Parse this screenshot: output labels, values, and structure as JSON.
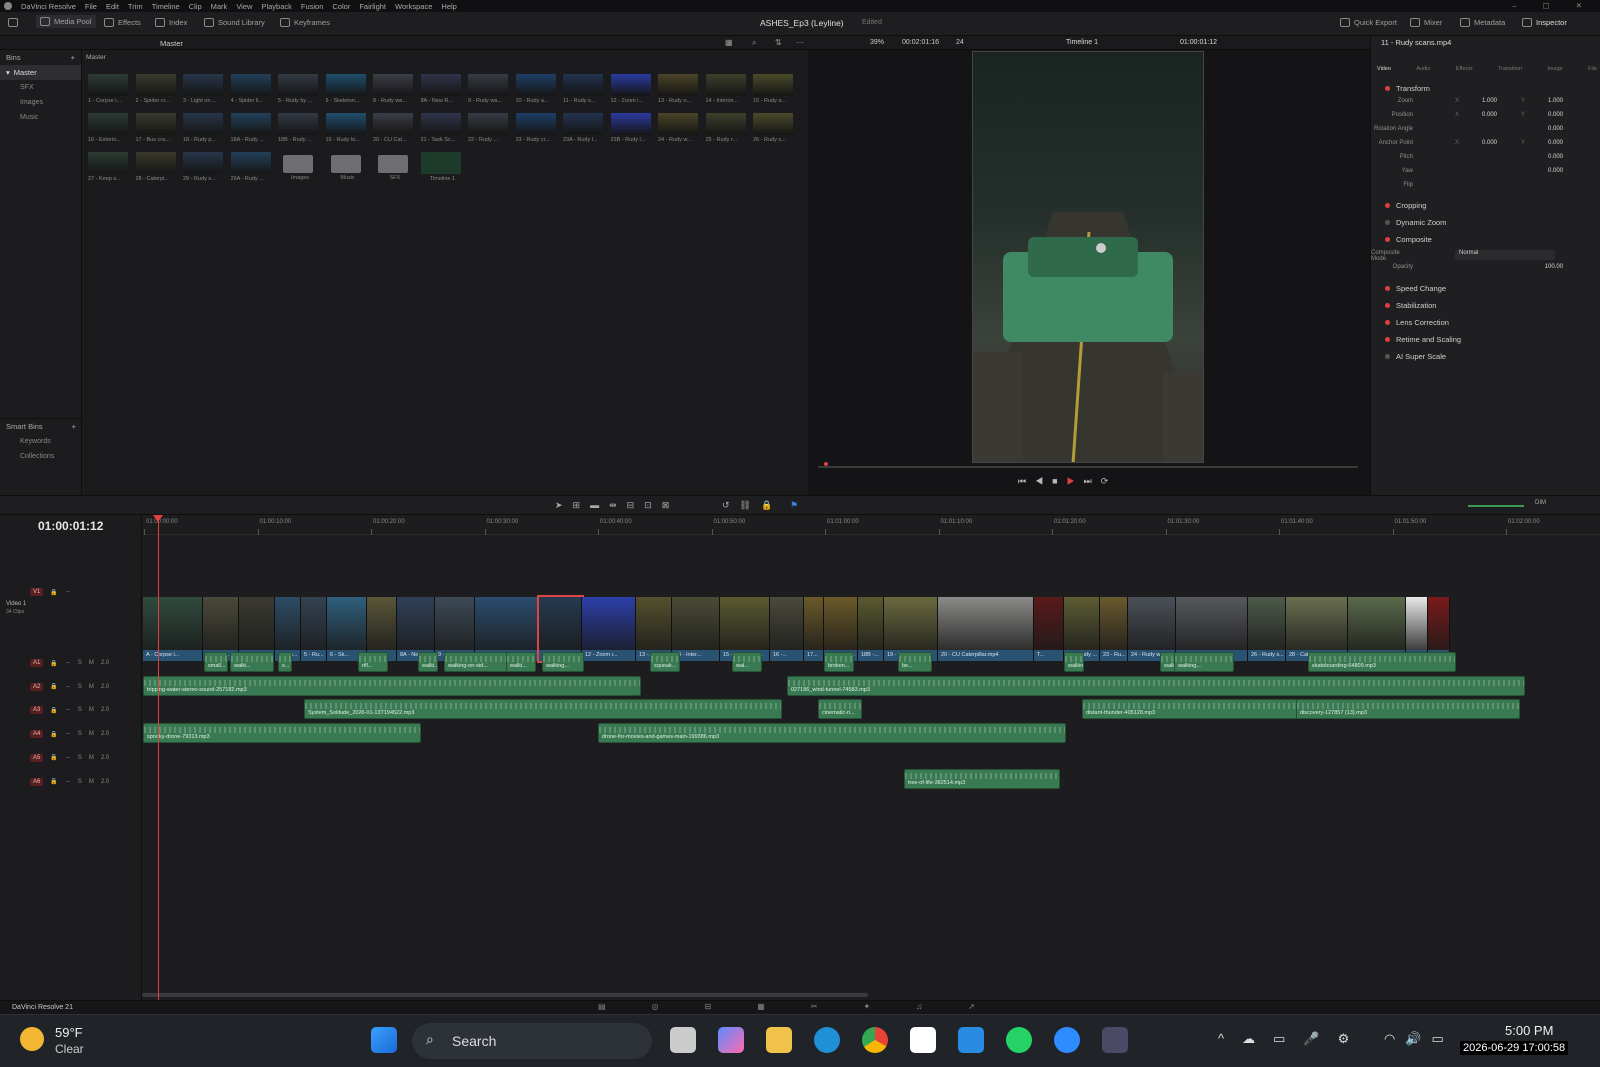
{
  "menubar": {
    "app": "DaVinci Resolve",
    "items": [
      "File",
      "Edit",
      "Trim",
      "Timeline",
      "Clip",
      "Mark",
      "View",
      "Playback",
      "Fusion",
      "Color",
      "Fairlight",
      "Workspace",
      "Help"
    ]
  },
  "toolbar": {
    "left": [
      "Media Pool",
      "Effects",
      "Index",
      "Sound Library",
      "Keyframes"
    ],
    "project_title": "ASHES_Ep3 (Leyline)",
    "project_state": "Edited",
    "right": [
      "Quick Export",
      "Mixer",
      "Metadata",
      "Inspector"
    ]
  },
  "pool": {
    "bins_label": "Bins",
    "current_bin": "Master",
    "bins": [
      "Master",
      "SFX",
      "Images",
      "Music"
    ],
    "smart_bins_label": "Smart Bins",
    "smart_bins": [
      "Keywords",
      "Collections"
    ],
    "header": "Master",
    "clips": [
      "1 - Corpse i...",
      "2 - Spider cr...",
      "3 - Light on ...",
      "4 - Spider li...",
      "5 - Rudy by ...",
      "6 - Skeleton...",
      "8 - Rudy wa...",
      "8A - New R...",
      "9 - Rudy wa...",
      "10 - Rudy a...",
      "11 - Rudy s...",
      "12 - Zoom i...",
      "13 - Rudy o...",
      "14 - Interior...",
      "15 - Rudy a...",
      "16 - Exterio...",
      "17 - Bus cra...",
      "18 - Rudy p...",
      "18A - Rudy ...",
      "18B - Rudy ...",
      "19 - Rudy lo...",
      "20 - CU Cat...",
      "21 - Task Sc...",
      "22 - Rudy ...",
      "23 - Rudy cr...",
      "23A - Rudy l...",
      "23B - Rudy l...",
      "24 - Rudy w...",
      "25 - Rudy r...",
      "26 - Rudy s...",
      "27 - Keep s...",
      "28 - Caterpi...",
      "29 - Rudy s...",
      "29A - Rudy ..."
    ],
    "folders": [
      "Images",
      "Music",
      "SFX"
    ],
    "timeline_item": "Timeline 1"
  },
  "viewer": {
    "zoom": "39%",
    "duration": "00:02:01:16",
    "fps": "24",
    "timeline_name": "Timeline 1",
    "timecode": "01:00:01:12"
  },
  "inspector": {
    "clip_name": "11 - Rudy scans.mp4",
    "tabs": [
      "Video",
      "Audio",
      "Effects",
      "Transition",
      "Image",
      "File"
    ],
    "sections": [
      "Transform",
      "Cropping",
      "Dynamic Zoom",
      "Composite",
      "Speed Change",
      "Stabilization",
      "Lens Correction",
      "Retime and Scaling",
      "AI Super Scale"
    ],
    "transform": {
      "zoom_label": "Zoom",
      "zoom_x": "1.000",
      "zoom_y": "1.000",
      "position_label": "Position",
      "pos_x": "0.000",
      "pos_y": "0.000",
      "rotation_label": "Rotation Angle",
      "rotation": "0.000",
      "anchor_label": "Anchor Point",
      "anchor_x": "0.000",
      "anchor_y": "0.000",
      "pitch_label": "Pitch",
      "pitch": "0.000",
      "yaw_label": "Yaw",
      "yaw": "0.000",
      "flip_label": "Flip"
    },
    "composite": {
      "mode_label": "Composite Mode",
      "mode": "Normal",
      "opacity_label": "Opacity",
      "opacity": "100.00"
    },
    "axis_x": "X",
    "axis_y": "Y"
  },
  "timeline": {
    "timecode": "01:00:01:12",
    "ruler": [
      "01:00:00:00",
      "01:00:10:00",
      "01:00:20:00",
      "01:00:30:00",
      "01:00:40:00",
      "01:00:50:00",
      "01:01:00:00",
      "01:01:10:00",
      "01:01:20:00",
      "01:01:30:00",
      "01:01:40:00",
      "01:01:50:00",
      "01:02:00:00"
    ],
    "video_track": {
      "tag": "V1",
      "name": "Video 1",
      "count": "34 Clips"
    },
    "audio_tracks": [
      {
        "tag": "A1",
        "level": "2.0"
      },
      {
        "tag": "A2",
        "level": "2.0"
      },
      {
        "tag": "A3",
        "level": "2.0"
      },
      {
        "tag": "A4",
        "level": "2.0"
      },
      {
        "tag": "A5",
        "level": "2.0"
      },
      {
        "tag": "A6",
        "level": "2.0"
      }
    ],
    "video_clips": [
      {
        "name": "A - Corpse i...",
        "color": "#304a3e"
      },
      {
        "name": "2 - Spide...",
        "color": "#4a4a3a"
      },
      {
        "name": "3 - Light o...",
        "color": "#3b3b32"
      },
      {
        "name": "4 - Sp...",
        "color": "#2e4c66"
      },
      {
        "name": "5 - Ru...",
        "color": "#344252"
      },
      {
        "name": "6 - Sk...",
        "color": "#2f5f7c"
      },
      {
        "name": "7 -...",
        "color": "#5a5638"
      },
      {
        "name": "8A - New ...",
        "color": "#31405a"
      },
      {
        "name": "9 - Rudy w...",
        "color": "#3d4a55"
      },
      {
        "name": "10 - Rudy approac...",
        "color": "#2c4d6e"
      },
      {
        "name": "11 - Ru...",
        "color": "#263a50"
      },
      {
        "name": "12 - Zoom i...",
        "color": "#2c3fa8"
      },
      {
        "name": "13 -...",
        "color": "#55502e"
      },
      {
        "name": "14 - Inter...",
        "color": "#4a4b35"
      },
      {
        "name": "15 - Rudy appr...",
        "color": "#5a5a32"
      },
      {
        "name": "16 -...",
        "color": "#4a4a3e"
      },
      {
        "name": "17...",
        "color": "#6a5a2a"
      },
      {
        "name": "18 - Rudy...",
        "color": "#6b5a28"
      },
      {
        "name": "18B -...",
        "color": "#5a5a30"
      },
      {
        "name": "19 - Rudy looks ...",
        "color": "#6a6a40"
      },
      {
        "name": "20 - CU Caterpillar.mp4",
        "color": "#8a8a88"
      },
      {
        "name": "T...",
        "color": "#5a1a1a"
      },
      {
        "name": "22 - Rudy ...",
        "color": "#5c5c34"
      },
      {
        "name": "23 - Ru...",
        "color": "#6a5a2e"
      },
      {
        "name": "24 - Rudy wa...",
        "color": "#4a5058"
      },
      {
        "name": "25 - Rudy return...",
        "color": "#565a5c"
      },
      {
        "name": "26 - Rudy s...",
        "color": "#4c5a4a"
      },
      {
        "name": "28 - Cate...",
        "color": "#6a7050"
      },
      {
        "name": "29A - Rudy skating...",
        "color": "#5a6a4a"
      },
      {
        "name": "ASHE...",
        "color": "#e8e8e8"
      },
      {
        "name": "AZ I...",
        "color": "#7a1a1a"
      }
    ],
    "audio_clips": {
      "a1": [
        "small...",
        "walki...",
        "s...",
        "rifl...",
        "walki...",
        "walking-on-sid...",
        "walki...",
        "walking...",
        "squeak...",
        "wal...",
        "broken...",
        "be...",
        "walkin...",
        "walking-on-si...",
        "walking...",
        "skateboarding-64809.mp3"
      ],
      "a2": [
        "tripping-water-stereo-sound-257182.mp3",
        "027186_wind-tunnel-74583.mp3"
      ],
      "a3": [
        "System_Solitude_2026-01-13T194522.mp3",
        "cinematic-ri...",
        "distant-thunder-405128.mp3",
        "discovery-127857 (13).mp3"
      ],
      "a4": [
        "spooky-drone-79313.mp3",
        "drone-for-movies-and-games-main-199386.mp3"
      ],
      "a6": [
        "tree-of-life-382514.mp3"
      ]
    }
  },
  "status": {
    "app": "DaVinci Resolve 21"
  },
  "taskbar": {
    "temp": "59°F",
    "weather": "Clear",
    "search": "Search",
    "time": "5:00 PM",
    "date": "2026-06-29 17:00:58"
  },
  "colors": {
    "accent": "#e04040",
    "audio_clip": "#3a7a52",
    "video_label": "#2a5273"
  }
}
